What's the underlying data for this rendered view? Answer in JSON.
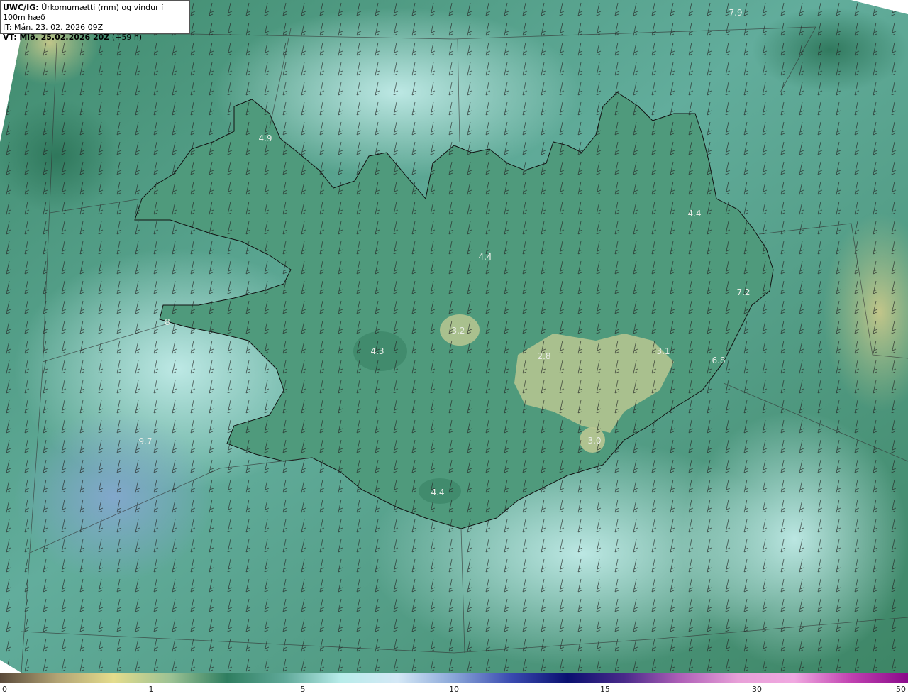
{
  "header": {
    "model": "UWC/IG:",
    "field": "Úrkomumætti (mm) og vindur í 100m hæð",
    "it_label": "IT:",
    "it_value": "Mán. 23. 02. 2026 09Z",
    "vt_label": "VT:",
    "vt_value": "Mið. 25.02.2026 20Z",
    "vt_offset": "(+59 h)"
  },
  "map_values": [
    {
      "text": "7.9"
    },
    {
      "text": "4.9"
    },
    {
      "text": "4.4"
    },
    {
      "text": "4.4"
    },
    {
      "text": "7.2"
    },
    {
      "text": "3.2"
    },
    {
      "text": "4.3"
    },
    {
      "text": "2.8"
    },
    {
      "text": "3.1"
    },
    {
      "text": "6.8"
    },
    {
      "text": "3.0"
    },
    {
      "text": "4.4"
    },
    {
      "text": "8"
    },
    {
      "text": "9.7"
    }
  ],
  "legend": {
    "ticks": [
      "0",
      "1",
      "5",
      "10",
      "15",
      "30",
      "50"
    ],
    "colors": [
      "#5a4a3a",
      "#b2a374",
      "#e4dc8c",
      "#9cc294",
      "#2f7e60",
      "#5fa898",
      "#b8ecea",
      "#d4e8f6",
      "#8aa6d8",
      "#3a4ab0",
      "#0a1070",
      "#4a2a8a",
      "#b060b8",
      "#e8a0d8",
      "#f0a8e0",
      "#c040b0",
      "#8a0a8a"
    ]
  },
  "colors": {
    "land_low": "#9cc294",
    "sea": "#5fa898",
    "coast": "#111111"
  }
}
